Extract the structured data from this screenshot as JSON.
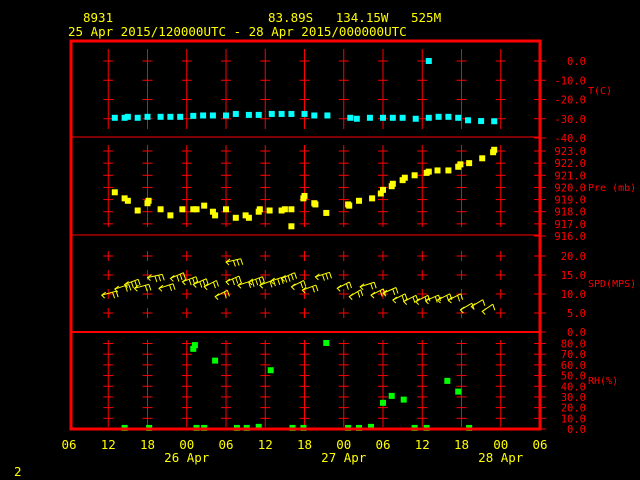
{
  "header": {
    "station_id": "8931",
    "location": "83.89S   134.15W   525M",
    "period": "25 Apr 2015/120000UTC - 28 Apr 2015/000000UTC"
  },
  "footer": {
    "page_number": "2"
  },
  "colors": {
    "frame": "#ff0000",
    "grid": "#ff0000",
    "text": "#ffff00",
    "temperature": "#00ffff",
    "pressure": "#ffff00",
    "wind": "#ffff00",
    "rh": "#00ff00"
  },
  "chart_data": [
    {
      "type": "scatter",
      "panel": "temperature",
      "ylabel": "T(C)",
      "ylim": [
        -40,
        0
      ],
      "yticks": [
        "0.0",
        "-10.0",
        "-20.0",
        "-30.0",
        "-40.0"
      ],
      "ytick_values": [
        0,
        -10,
        -20,
        -30,
        -40
      ],
      "grid": true,
      "points": [
        [
          "2015-04-25 13:00",
          -29.5
        ],
        [
          "2015-04-25 14:30",
          -29.5
        ],
        [
          "2015-04-25 15:00",
          -29.0
        ],
        [
          "2015-04-25 16:30",
          -29.5
        ],
        [
          "2015-04-25 18:00",
          -29.0
        ],
        [
          "2015-04-25 20:00",
          -29.0
        ],
        [
          "2015-04-25 21:30",
          -29.0
        ],
        [
          "2015-04-25 23:00",
          -29.0
        ],
        [
          "2015-04-26 01:00",
          -28.5
        ],
        [
          "2015-04-26 02:30",
          -28.3
        ],
        [
          "2015-04-26 04:00",
          -28.3
        ],
        [
          "2015-04-26 06:00",
          -28.3
        ],
        [
          "2015-04-26 07:30",
          -27.5
        ],
        [
          "2015-04-26 09:30",
          -28.0
        ],
        [
          "2015-04-26 11:00",
          -28.0
        ],
        [
          "2015-04-26 13:00",
          -27.5
        ],
        [
          "2015-04-26 14:30",
          -27.5
        ],
        [
          "2015-04-26 16:00",
          -27.5
        ],
        [
          "2015-04-26 18:00",
          -27.5
        ],
        [
          "2015-04-26 19:30",
          -28.3
        ],
        [
          "2015-04-26 21:30",
          -28.3
        ],
        [
          "2015-04-27 01:00",
          -29.5
        ],
        [
          "2015-04-27 02:00",
          -30.0
        ],
        [
          "2015-04-27 04:00",
          -29.5
        ],
        [
          "2015-04-27 06:00",
          -29.5
        ],
        [
          "2015-04-27 07:30",
          -29.5
        ],
        [
          "2015-04-27 09:00",
          -29.5
        ],
        [
          "2015-04-27 11:00",
          -30.0
        ],
        [
          "2015-04-27 13:00",
          -29.5
        ],
        [
          "2015-04-27 13:00",
          0.0
        ],
        [
          "2015-04-27 14:30",
          -29.0
        ],
        [
          "2015-04-27 16:00",
          -29.0
        ],
        [
          "2015-04-27 17:30",
          -29.5
        ],
        [
          "2015-04-27 19:00",
          -30.8
        ],
        [
          "2015-04-27 21:00",
          -31.2
        ],
        [
          "2015-04-27 23:00",
          -31.3
        ]
      ]
    },
    {
      "type": "scatter",
      "panel": "pressure",
      "ylabel": "Pre (mb)",
      "ylim": [
        916,
        923
      ],
      "yticks": [
        "923.0",
        "922.0",
        "921.0",
        "920.0",
        "919.0",
        "918.0",
        "917.0",
        "916.0"
      ],
      "ytick_values": [
        923,
        922,
        921,
        920,
        919,
        918,
        917,
        916
      ],
      "grid": true,
      "points": [
        [
          "2015-04-25 13:00",
          919.6
        ],
        [
          "2015-04-25 14:30",
          919.1
        ],
        [
          "2015-04-25 15:00",
          918.9
        ],
        [
          "2015-04-25 16:30",
          918.1
        ],
        [
          "2015-04-25 18:00",
          918.7
        ],
        [
          "2015-04-25 18:10",
          918.9
        ],
        [
          "2015-04-25 20:00",
          918.2
        ],
        [
          "2015-04-25 21:30",
          917.7
        ],
        [
          "2015-04-25 23:20",
          918.2
        ],
        [
          "2015-04-26 01:00",
          918.2
        ],
        [
          "2015-04-26 01:30",
          918.2
        ],
        [
          "2015-04-26 02:40",
          918.5
        ],
        [
          "2015-04-26 04:00",
          918.0
        ],
        [
          "2015-04-26 04:20",
          917.7
        ],
        [
          "2015-04-26 06:00",
          918.2
        ],
        [
          "2015-04-26 07:30",
          917.5
        ],
        [
          "2015-04-26 09:00",
          917.7
        ],
        [
          "2015-04-26 09:30",
          917.5
        ],
        [
          "2015-04-26 11:00",
          918.0
        ],
        [
          "2015-04-26 11:10",
          918.2
        ],
        [
          "2015-04-26 12:40",
          918.1
        ],
        [
          "2015-04-26 14:30",
          918.1
        ],
        [
          "2015-04-26 15:00",
          918.2
        ],
        [
          "2015-04-26 16:00",
          918.2
        ],
        [
          "2015-04-26 16:00",
          916.8
        ],
        [
          "2015-04-26 17:50",
          919.1
        ],
        [
          "2015-04-26 18:00",
          919.3
        ],
        [
          "2015-04-26 19:30",
          918.7
        ],
        [
          "2015-04-26 19:40",
          918.6
        ],
        [
          "2015-04-26 21:20",
          917.9
        ],
        [
          "2015-04-27 00:40",
          918.6
        ],
        [
          "2015-04-27 00:50",
          918.5
        ],
        [
          "2015-04-27 02:20",
          918.9
        ],
        [
          "2015-04-27 04:20",
          919.1
        ],
        [
          "2015-04-27 05:40",
          919.5
        ],
        [
          "2015-04-27 06:00",
          919.8
        ],
        [
          "2015-04-27 07:20",
          920.1
        ],
        [
          "2015-04-27 07:30",
          920.3
        ],
        [
          "2015-04-27 09:00",
          920.6
        ],
        [
          "2015-04-27 09:20",
          920.8
        ],
        [
          "2015-04-27 10:50",
          921.0
        ],
        [
          "2015-04-27 12:40",
          921.2
        ],
        [
          "2015-04-27 13:00",
          921.3
        ],
        [
          "2015-04-27 14:20",
          921.4
        ],
        [
          "2015-04-27 16:00",
          921.4
        ],
        [
          "2015-04-27 17:30",
          921.7
        ],
        [
          "2015-04-27 17:50",
          921.9
        ],
        [
          "2015-04-27 19:10",
          922.0
        ],
        [
          "2015-04-27 21:10",
          922.4
        ],
        [
          "2015-04-27 22:50",
          922.9
        ],
        [
          "2015-04-27 23:00",
          923.1
        ]
      ]
    },
    {
      "type": "wind_barb",
      "panel": "wind",
      "ylabel": "SPD(MPS)",
      "ylim": [
        0,
        20
      ],
      "yticks": [
        "20.0",
        "15.0",
        "10.0",
        "5.0",
        "0.0"
      ],
      "ytick_values": [
        20,
        15,
        10,
        5,
        0
      ],
      "grid": true,
      "points": [
        [
          "2015-04-25 11:00",
          9.7,
          75
        ],
        [
          "2015-04-25 13:00",
          11.3,
          70
        ],
        [
          "2015-04-25 14:30",
          12.5,
          65
        ],
        [
          "2015-04-25 16:00",
          11.5,
          75
        ],
        [
          "2015-04-25 18:00",
          14.3,
          80
        ],
        [
          "2015-04-25 19:45",
          11.5,
          70
        ],
        [
          "2015-04-25 21:30",
          14.1,
          60
        ],
        [
          "2015-04-25 23:20",
          13.2,
          65
        ],
        [
          "2015-04-26 01:00",
          12.5,
          60
        ],
        [
          "2015-04-26 02:40",
          11.9,
          55
        ],
        [
          "2015-04-26 04:20",
          9.3,
          55
        ],
        [
          "2015-04-26 06:00",
          18.4,
          80
        ],
        [
          "2015-04-26 06:00",
          13.2,
          60
        ],
        [
          "2015-04-26 07:50",
          12.3,
          70
        ],
        [
          "2015-04-26 09:30",
          13.2,
          65
        ],
        [
          "2015-04-26 11:10",
          12.3,
          65
        ],
        [
          "2015-04-26 12:50",
          13.4,
          70
        ],
        [
          "2015-04-26 14:30",
          14.1,
          60
        ],
        [
          "2015-04-26 16:00",
          11.9,
          55
        ],
        [
          "2015-04-26 17:40",
          11.0,
          65
        ],
        [
          "2015-04-26 19:40",
          14.5,
          70
        ],
        [
          "2015-04-26 23:00",
          11.5,
          55
        ],
        [
          "2015-04-27 00:50",
          9.3,
          50
        ],
        [
          "2015-04-27 02:30",
          11.9,
          70
        ],
        [
          "2015-04-27 04:10",
          9.7,
          55
        ],
        [
          "2015-04-27 06:00",
          10.2,
          60
        ],
        [
          "2015-04-27 07:30",
          8.4,
          55
        ],
        [
          "2015-04-27 09:10",
          8.0,
          55
        ],
        [
          "2015-04-27 11:00",
          8.0,
          55
        ],
        [
          "2015-04-27 12:30",
          8.2,
          60
        ],
        [
          "2015-04-27 14:20",
          8.4,
          55
        ],
        [
          "2015-04-27 16:00",
          8.4,
          55
        ],
        [
          "2015-04-27 17:50",
          5.8,
          50
        ],
        [
          "2015-04-27 19:30",
          6.7,
          50
        ],
        [
          "2015-04-27 21:10",
          5.4,
          45
        ]
      ]
    },
    {
      "type": "scatter",
      "panel": "rh",
      "ylabel": "RH(%)",
      "ylim": [
        0,
        80
      ],
      "yticks": [
        "80.0",
        "70.0",
        "60.0",
        "50.0",
        "40.0",
        "30.0",
        "20.0",
        "10.0",
        "0.0"
      ],
      "ytick_values": [
        80,
        70,
        60,
        50,
        40,
        30,
        20,
        10,
        0
      ],
      "grid": true,
      "points": [
        [
          "2015-04-25 14:30",
          1
        ],
        [
          "2015-04-25 18:15",
          1
        ],
        [
          "2015-04-26 01:00",
          75
        ],
        [
          "2015-04-26 01:15",
          78.5
        ],
        [
          "2015-04-26 01:30",
          1
        ],
        [
          "2015-04-26 02:40",
          1
        ],
        [
          "2015-04-26 04:20",
          64
        ],
        [
          "2015-04-26 07:40",
          1
        ],
        [
          "2015-04-26 09:10",
          1
        ],
        [
          "2015-04-26 11:00",
          2
        ],
        [
          "2015-04-26 12:50",
          55
        ],
        [
          "2015-04-26 16:10",
          1
        ],
        [
          "2015-04-26 17:50",
          1
        ],
        [
          "2015-04-26 21:20",
          80.5
        ],
        [
          "2015-04-27 00:40",
          1
        ],
        [
          "2015-04-27 02:20",
          1
        ],
        [
          "2015-04-27 04:10",
          2
        ],
        [
          "2015-04-27 06:00",
          24.5
        ],
        [
          "2015-04-27 07:20",
          31
        ],
        [
          "2015-04-27 09:10",
          27.5
        ],
        [
          "2015-04-27 10:50",
          1
        ],
        [
          "2015-04-27 12:40",
          1
        ],
        [
          "2015-04-27 15:50",
          45
        ],
        [
          "2015-04-27 17:30",
          35
        ],
        [
          "2015-04-27 19:10",
          1
        ]
      ]
    }
  ],
  "x_axis": {
    "range": [
      "2015-04-25 06:00",
      "2015-04-28 06:00"
    ],
    "tick_labels": [
      "06",
      "12",
      "18",
      "00",
      "06",
      "12",
      "18",
      "00",
      "06",
      "12",
      "18",
      "00",
      "06"
    ],
    "date_labels": [
      "26 Apr",
      "27 Apr",
      "28 Apr"
    ]
  }
}
